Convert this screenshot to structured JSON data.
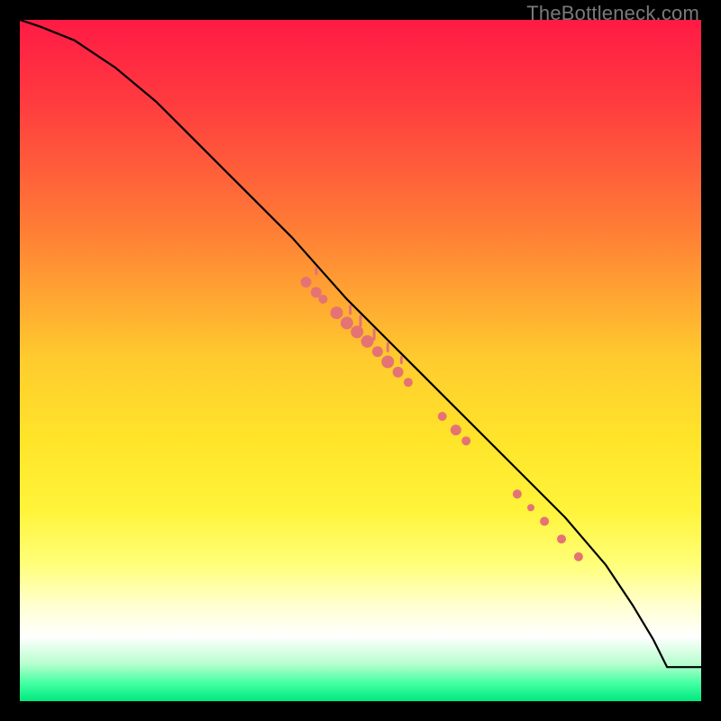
{
  "watermark": "TheBottleneck.com",
  "chart_data": {
    "type": "line",
    "title": "",
    "xlabel": "",
    "ylabel": "",
    "xlim": [
      0,
      100
    ],
    "ylim": [
      0,
      100
    ],
    "gradient_stops": [
      {
        "offset": 0.0,
        "color": "#ff1a45"
      },
      {
        "offset": 0.12,
        "color": "#ff3b3f"
      },
      {
        "offset": 0.3,
        "color": "#ff7a36"
      },
      {
        "offset": 0.5,
        "color": "#ffcc2e"
      },
      {
        "offset": 0.62,
        "color": "#ffe52a"
      },
      {
        "offset": 0.72,
        "color": "#fff43a"
      },
      {
        "offset": 0.8,
        "color": "#ffff7a"
      },
      {
        "offset": 0.86,
        "color": "#ffffd0"
      },
      {
        "offset": 0.905,
        "color": "#ffffff"
      },
      {
        "offset": 0.945,
        "color": "#b8ffcf"
      },
      {
        "offset": 0.975,
        "color": "#3fffa0"
      },
      {
        "offset": 1.0,
        "color": "#00e880"
      }
    ],
    "series": [
      {
        "name": "curve",
        "x": [
          0,
          3,
          8,
          14,
          20,
          26,
          32,
          40,
          48,
          56,
          64,
          72,
          80,
          86,
          90,
          93,
          95,
          100
        ],
        "y": [
          100,
          99,
          97,
          93,
          88,
          82,
          76,
          68,
          59,
          51,
          43,
          35,
          27,
          20,
          14,
          9,
          5,
          5
        ]
      }
    ],
    "scatter": [
      {
        "x": 42.0,
        "y": 61.5,
        "r": 6
      },
      {
        "x": 43.5,
        "y": 60.0,
        "r": 6
      },
      {
        "x": 44.5,
        "y": 59.0,
        "r": 5
      },
      {
        "x": 46.5,
        "y": 57.0,
        "r": 7
      },
      {
        "x": 48.0,
        "y": 55.5,
        "r": 7
      },
      {
        "x": 49.5,
        "y": 54.2,
        "r": 7
      },
      {
        "x": 51.0,
        "y": 52.8,
        "r": 7
      },
      {
        "x": 52.5,
        "y": 51.3,
        "r": 6
      },
      {
        "x": 54.0,
        "y": 49.8,
        "r": 7
      },
      {
        "x": 55.5,
        "y": 48.3,
        "r": 6
      },
      {
        "x": 57.0,
        "y": 46.8,
        "r": 5
      },
      {
        "x": 62.0,
        "y": 41.8,
        "r": 5
      },
      {
        "x": 64.0,
        "y": 39.8,
        "r": 6
      },
      {
        "x": 65.5,
        "y": 38.2,
        "r": 5
      },
      {
        "x": 73.0,
        "y": 30.4,
        "r": 5
      },
      {
        "x": 75.0,
        "y": 28.4,
        "r": 4
      },
      {
        "x": 77.0,
        "y": 26.4,
        "r": 5
      },
      {
        "x": 79.5,
        "y": 23.8,
        "r": 5
      },
      {
        "x": 82.0,
        "y": 21.2,
        "r": 5
      }
    ],
    "ticks_below_curve": [
      {
        "x": 43.5,
        "len": 6
      },
      {
        "x": 48.5,
        "len": 8
      },
      {
        "x": 50.0,
        "len": 10
      },
      {
        "x": 52.0,
        "len": 10
      },
      {
        "x": 54.0,
        "len": 8
      },
      {
        "x": 56.0,
        "len": 6
      }
    ],
    "point_color": "#e57373",
    "curve_color": "#000000"
  }
}
